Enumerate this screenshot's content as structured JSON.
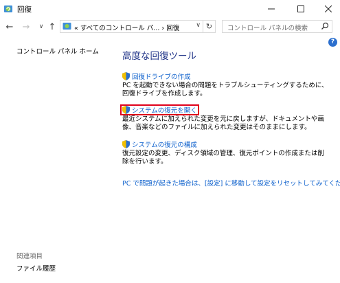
{
  "window": {
    "title": "回復"
  },
  "address": {
    "path": "«  すべてのコントロール パ...  ›  回復"
  },
  "search": {
    "placeholder": "コントロール パネルの検索"
  },
  "sidebar": {
    "home_label": "コントロール パネル ホーム",
    "related_heading": "関連項目",
    "related_link": "ファイル履歴"
  },
  "main": {
    "title": "高度な回復ツール",
    "items": [
      {
        "link": "回復ドライブの作成",
        "desc": "PC を起動できない場合の問題をトラブルシューティングするために、回復ドライブを作成します。"
      },
      {
        "link": "システムの復元を開く",
        "desc": "最近システムに加えられた変更を元に戻しますが、ドキュメントや画像、音楽などのファイルに加えられた変更はそのままにします。"
      },
      {
        "link": "システムの復元の構成",
        "desc": "復元設定の変更、ディスク領域の管理、復元ポイントの作成または削除を行います。"
      }
    ],
    "bottom_link": "PC で問題が起きた場合は、[設定] に移動して設定をリセットしてみてください"
  },
  "colors": {
    "link": "#0b5fcc",
    "title": "#1e3287",
    "highlight": "#e0001a"
  }
}
